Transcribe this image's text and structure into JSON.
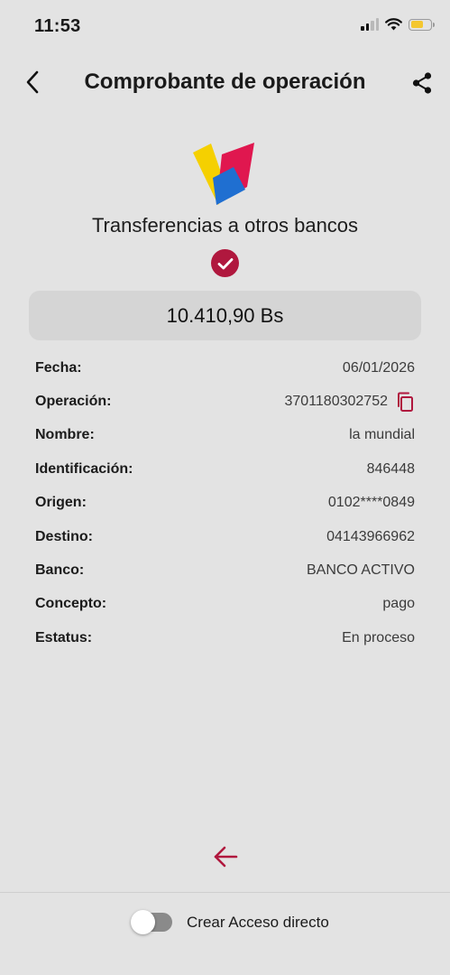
{
  "status_bar": {
    "time": "11:53"
  },
  "header": {
    "title": "Comprobante de operación"
  },
  "transaction": {
    "type": "Transferencias a otros bancos",
    "amount": "10.410,90 Bs"
  },
  "details": [
    {
      "label": "Fecha:",
      "value": "06/01/2026"
    },
    {
      "label": "Operación:",
      "value": "3701180302752"
    },
    {
      "label": "Nombre:",
      "value": "la mundial"
    },
    {
      "label": "Identificación:",
      "value": "846448"
    },
    {
      "label": "Origen:",
      "value": "0102****0849"
    },
    {
      "label": "Destino:",
      "value": "04143966962"
    },
    {
      "label": "Banco:",
      "value": "BANCO ACTIVO"
    },
    {
      "label": "Concepto:",
      "value": "pago"
    },
    {
      "label": "Estatus:",
      "value": "En proceso"
    }
  ],
  "footer": {
    "shortcut_label": "Crear Acceso directo",
    "shortcut_enabled": false
  },
  "colors": {
    "accent": "#b0183e",
    "background": "#e3e3e3",
    "amount_box": "#d5d5d5",
    "logo_yellow": "#f5d000",
    "logo_blue": "#1f6fd1",
    "logo_red": "#e0174f"
  },
  "icons": {
    "back": "chevron-left-icon",
    "share": "share-icon",
    "status": "check-circle-icon",
    "copy": "copy-icon",
    "return": "arrow-left-icon"
  }
}
